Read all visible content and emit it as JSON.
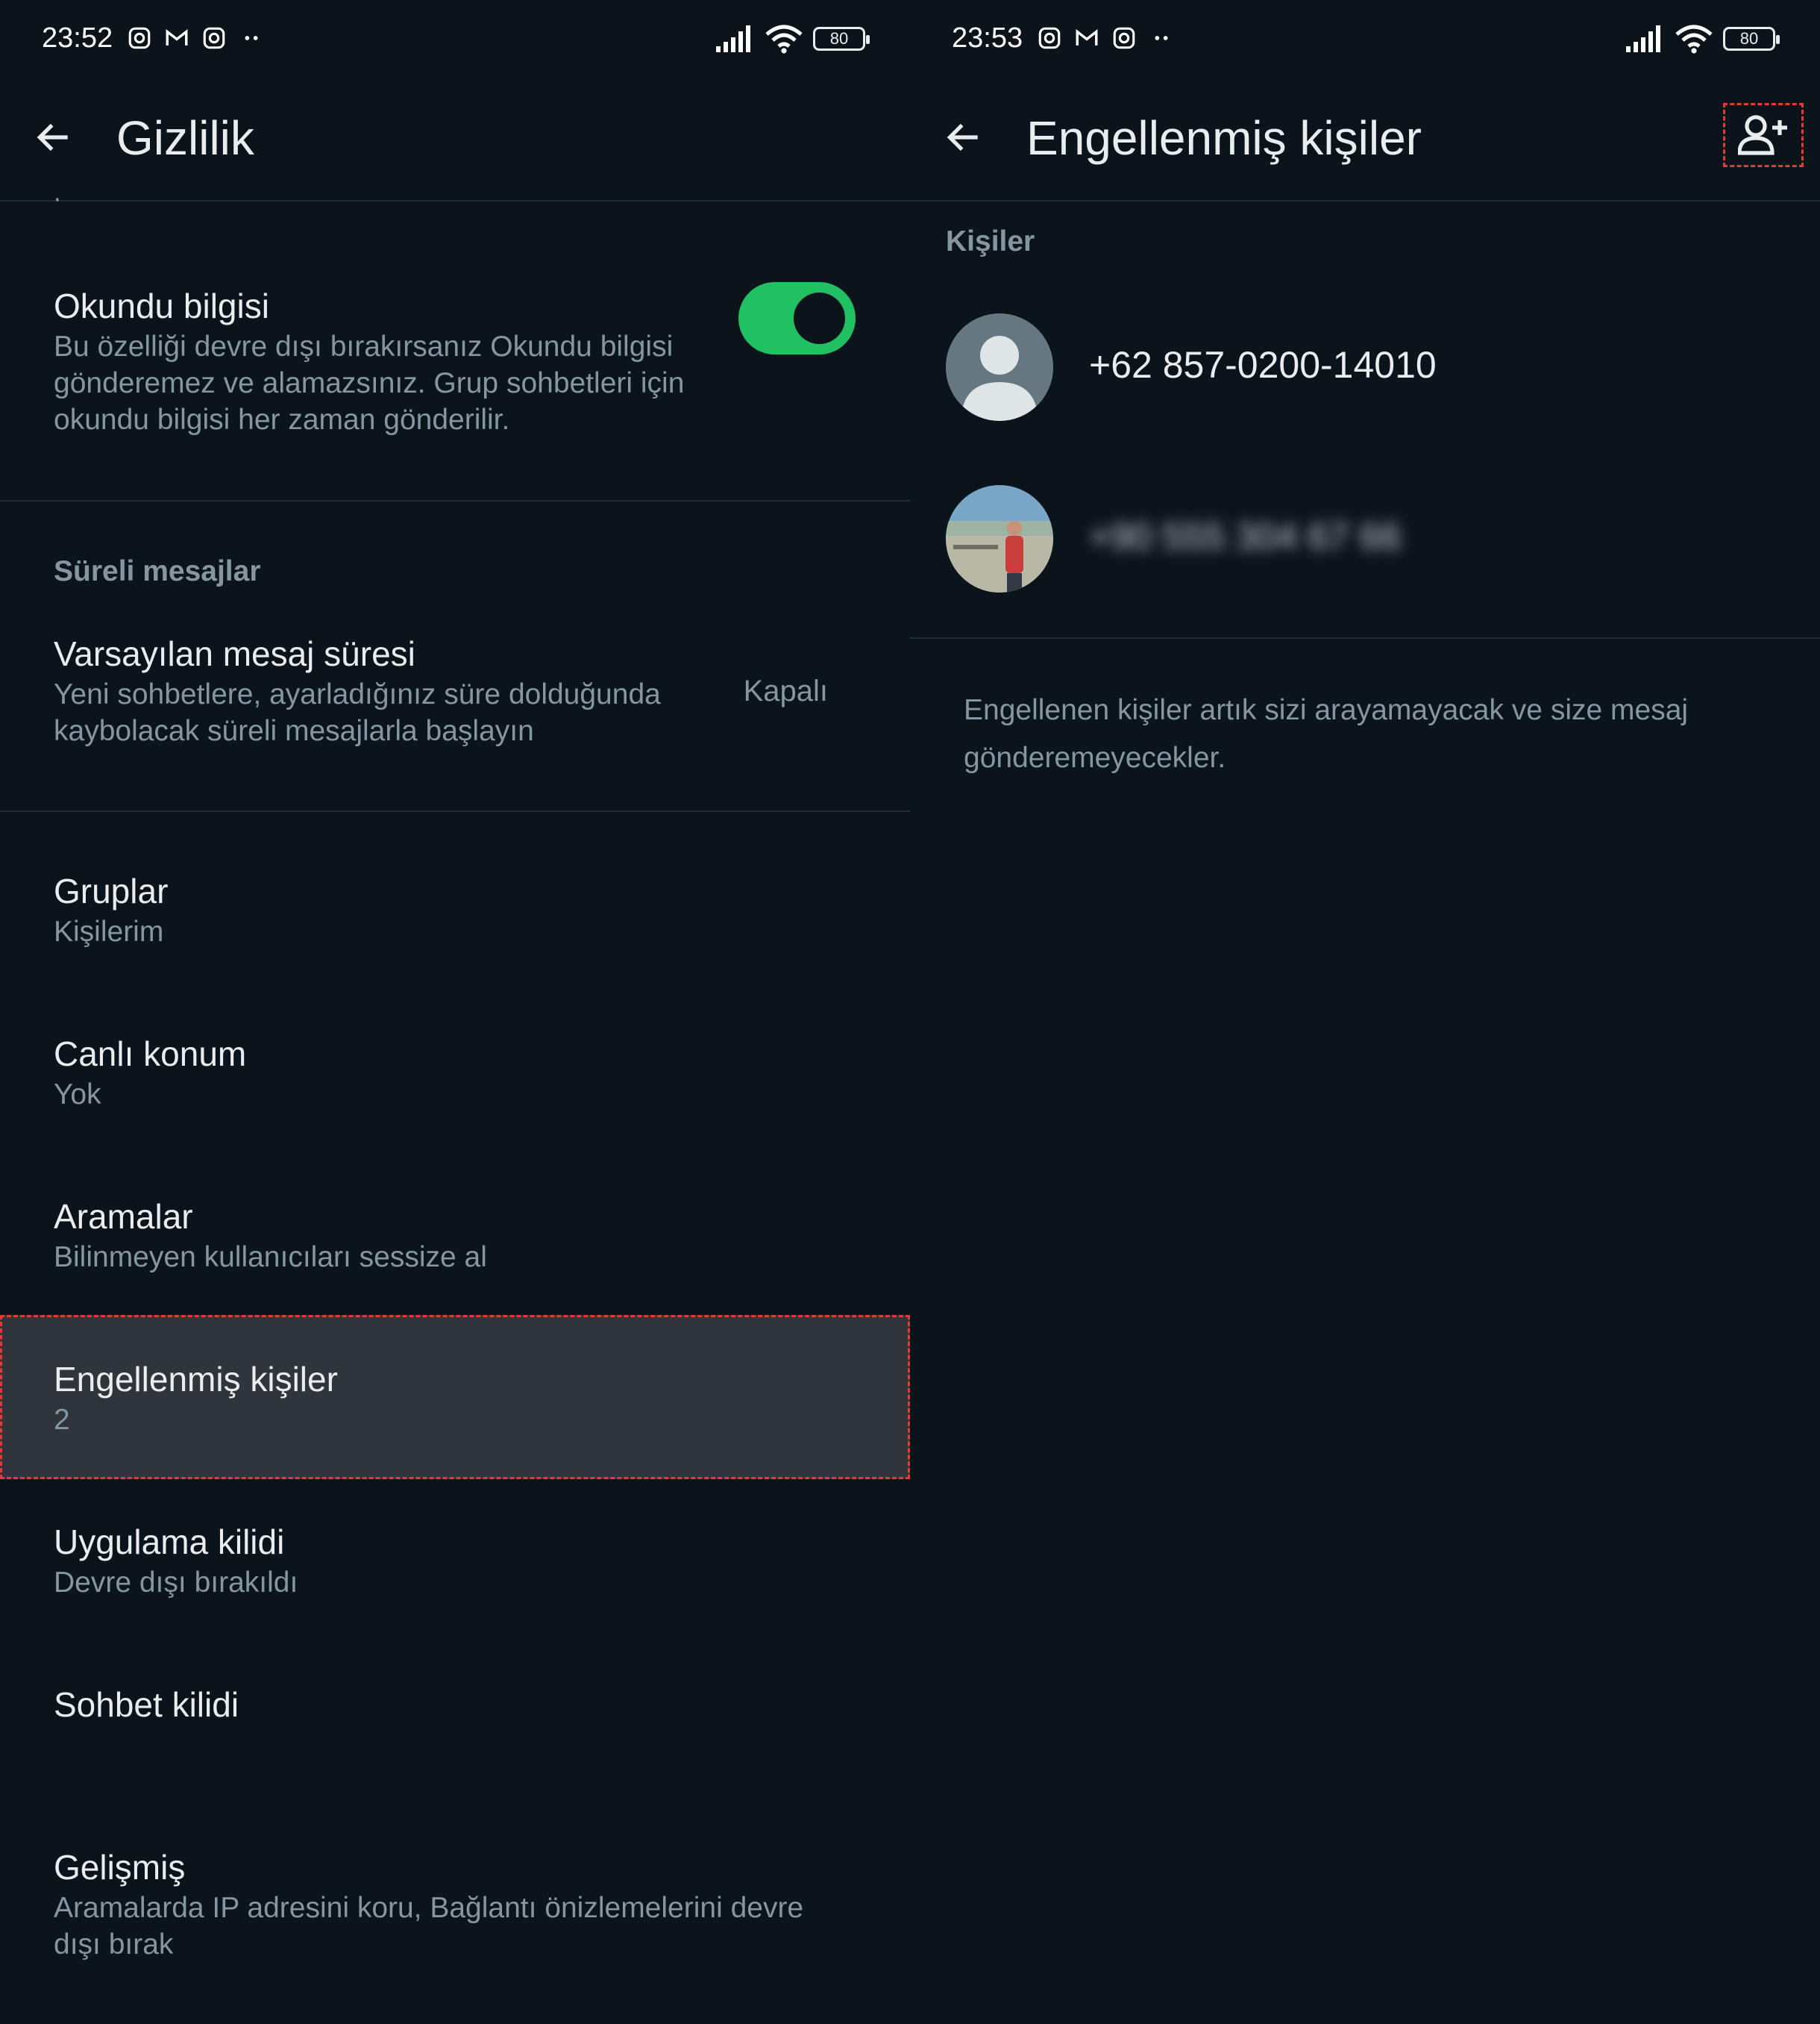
{
  "left": {
    "status": {
      "time": "23:52",
      "battery": "80"
    },
    "app_bar": {
      "title": "Gizlilik"
    },
    "read_receipts": {
      "title": "Okundu bilgisi",
      "subtitle": "Bu özelliği devre dışı bırakırsanız Okundu bilgisi gönderemez ve alamazsınız. Grup sohbetleri için okundu bilgisi her zaman gönderilir.",
      "enabled": true
    },
    "disappearing_section": "Süreli mesajlar",
    "default_timer": {
      "title": "Varsayılan mesaj süresi",
      "subtitle": "Yeni sohbetlere, ayarladığınız süre dolduğunda kaybolacak süreli mesajlarla başlayın",
      "value": "Kapalı"
    },
    "groups": {
      "title": "Gruplar",
      "subtitle": "Kişilerim"
    },
    "live_location": {
      "title": "Canlı konum",
      "subtitle": "Yok"
    },
    "calls": {
      "title": "Aramalar",
      "subtitle": "Bilinmeyen kullanıcıları sessize al"
    },
    "blocked": {
      "title": "Engellenmiş kişiler",
      "subtitle": "2"
    },
    "app_lock": {
      "title": "Uygulama kilidi",
      "subtitle": "Devre dışı bırakıldı"
    },
    "chat_lock": {
      "title": "Sohbet kilidi"
    },
    "advanced": {
      "title": "Gelişmiş",
      "subtitle": "Aramalarda IP adresini koru, Bağlantı önizlemelerini devre dışı bırak"
    }
  },
  "right": {
    "status": {
      "time": "23:53",
      "battery": "80"
    },
    "app_bar": {
      "title": "Engellenmiş kişiler"
    },
    "section": "Kişiler",
    "contacts": [
      {
        "name": "+62 857-0200-14010"
      },
      {
        "name": "+90 555 304 67 66"
      }
    ],
    "info": "Engellenen kişiler artık sizi arayamayacak ve size mesaj gönderemeyecekler."
  },
  "colors": {
    "background": "#0b141a",
    "toggle_on": "#21c063",
    "highlight": "#2f353b",
    "annotation": "#e53935"
  },
  "icons": [
    "instagram-icon",
    "gmail-icon",
    "more-dots-icon",
    "signal-icon",
    "wifi-icon",
    "battery-icon",
    "back-arrow-icon",
    "add-contact-icon",
    "default-avatar-icon"
  ]
}
